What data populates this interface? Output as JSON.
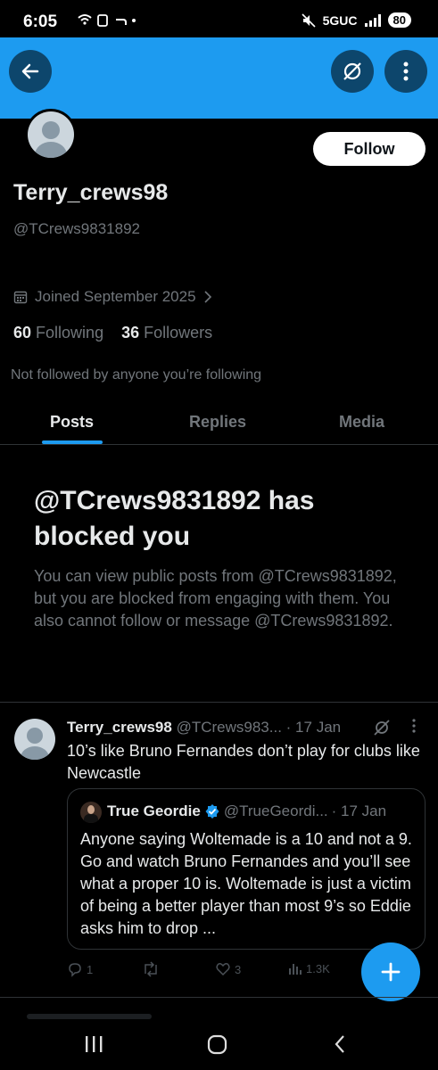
{
  "status_bar": {
    "time": "6:05",
    "network": "5GUC",
    "battery": "80"
  },
  "header": {
    "back_icon": "arrow-left-icon",
    "grok_icon": "grok-icon",
    "more_icon": "more-vertical-icon"
  },
  "profile": {
    "follow_label": "Follow",
    "display_name": "Terry_crews98",
    "handle": "@TCrews9831892",
    "joined": "Joined September 2025",
    "following_count": "60",
    "following_label": "Following",
    "followers_count": "36",
    "followers_label": "Followers",
    "not_followed": "Not followed by anyone you’re following"
  },
  "tabs": [
    {
      "label": "Posts",
      "active": true
    },
    {
      "label": "Replies",
      "active": false
    },
    {
      "label": "Media",
      "active": false
    }
  ],
  "blocked": {
    "title": "@TCrews9831892 has blocked you",
    "message": "You can view public posts from @TCrews9831892, but you are blocked from engaging with them. You also cannot follow or message @TCrews9831892."
  },
  "tweet": {
    "name": "Terry_crews98",
    "handle": "@TCrews983...",
    "date": "· 17 Jan",
    "text": "10’s like Bruno Fernandes don’t play for clubs like Newcastle",
    "quote": {
      "name": "True Geordie",
      "handle": "@TrueGeordi...",
      "date": "· 17 Jan",
      "text": "Anyone saying Woltemade is a 10 and not a 9. Go and watch Bruno Fernandes and you’ll see what a proper 10 is. Woltemade is just a victim of being a better player than most 9’s so Eddie asks him to drop ..."
    },
    "actions": {
      "replies": "1",
      "reposts": "",
      "likes": "3",
      "views": "1.3K"
    }
  },
  "colors": {
    "accent": "#1d9bf0",
    "background": "#000000",
    "muted": "#71767b"
  }
}
